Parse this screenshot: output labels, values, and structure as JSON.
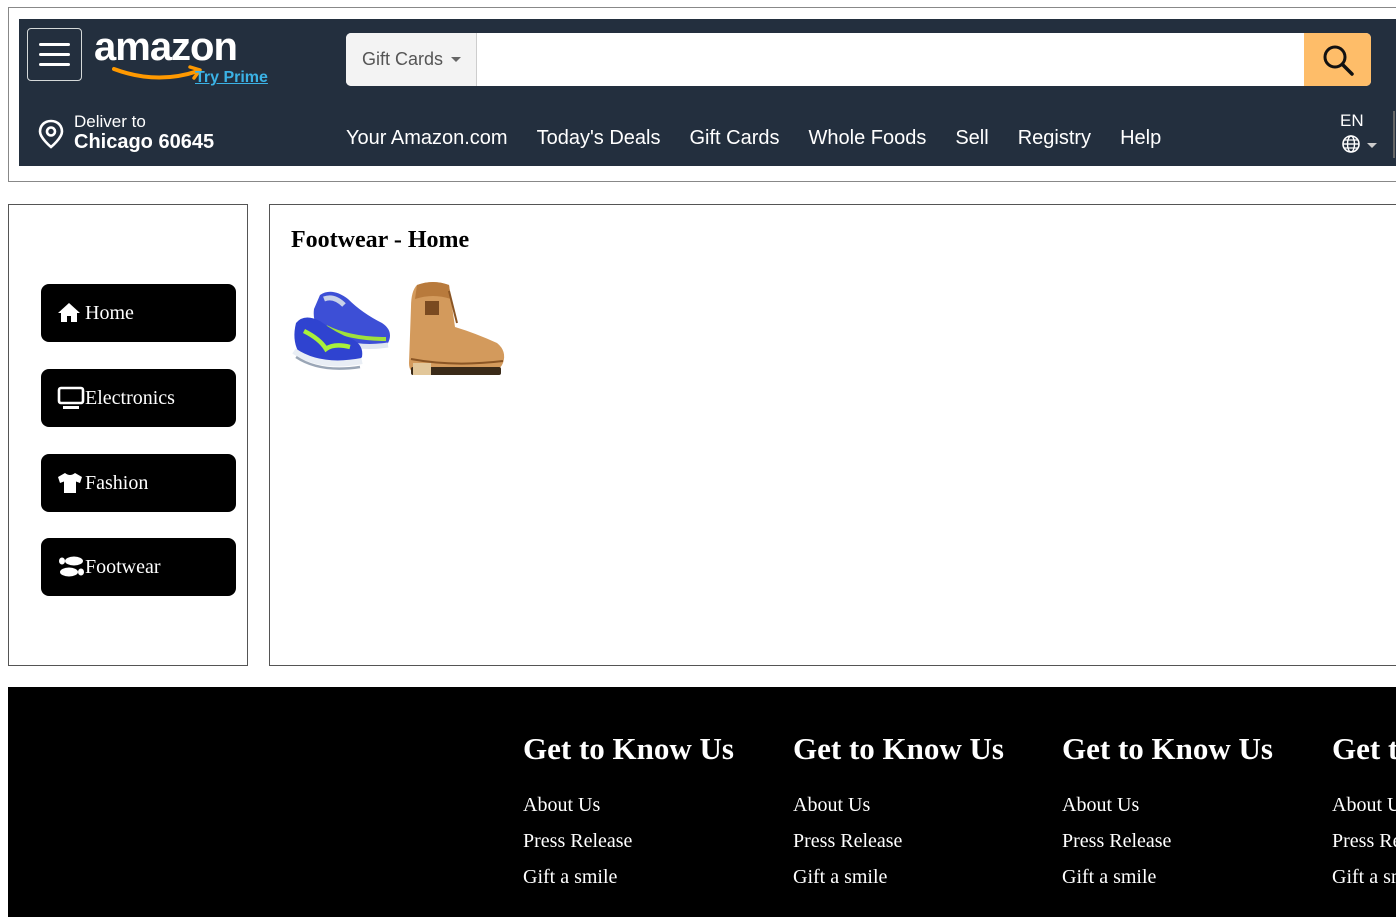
{
  "header": {
    "logo_text": "amazon",
    "prime_link": "Try Prime",
    "search": {
      "category": "Gift Cards",
      "value": "",
      "placeholder": ""
    },
    "deliver": {
      "label": "Deliver to",
      "location": "Chicago 60645"
    },
    "nav_links": [
      "Your Amazon.com",
      "Today's Deals",
      "Gift Cards",
      "Whole Foods",
      "Sell",
      "Registry",
      "Help"
    ],
    "language": "EN",
    "colors": {
      "navbar": "#232f3e",
      "search_button": "#febd69",
      "prime": "#3bb2e5"
    }
  },
  "sidebar": {
    "items": [
      {
        "label": "Home",
        "icon": "home-icon"
      },
      {
        "label": "Electronics",
        "icon": "monitor-icon"
      },
      {
        "label": "Fashion",
        "icon": "tshirt-icon"
      },
      {
        "label": "Footwear",
        "icon": "shoe-prints-icon"
      }
    ]
  },
  "main": {
    "title": "Footwear - Home",
    "products": [
      {
        "name": "blue-running-shoe"
      },
      {
        "name": "tan-leather-boot"
      }
    ]
  },
  "footer": {
    "columns": [
      {
        "heading": "Get to Know Us",
        "links": [
          "About Us",
          "Press Release",
          "Gift a smile"
        ]
      },
      {
        "heading": "Get to Know Us",
        "links": [
          "About Us",
          "Press Release",
          "Gift a smile"
        ]
      },
      {
        "heading": "Get to Know Us",
        "links": [
          "About Us",
          "Press Release",
          "Gift a smile"
        ]
      },
      {
        "heading": "Get to Know Us",
        "links": [
          "About Us",
          "Press Release",
          "Gift a smile"
        ]
      }
    ]
  }
}
